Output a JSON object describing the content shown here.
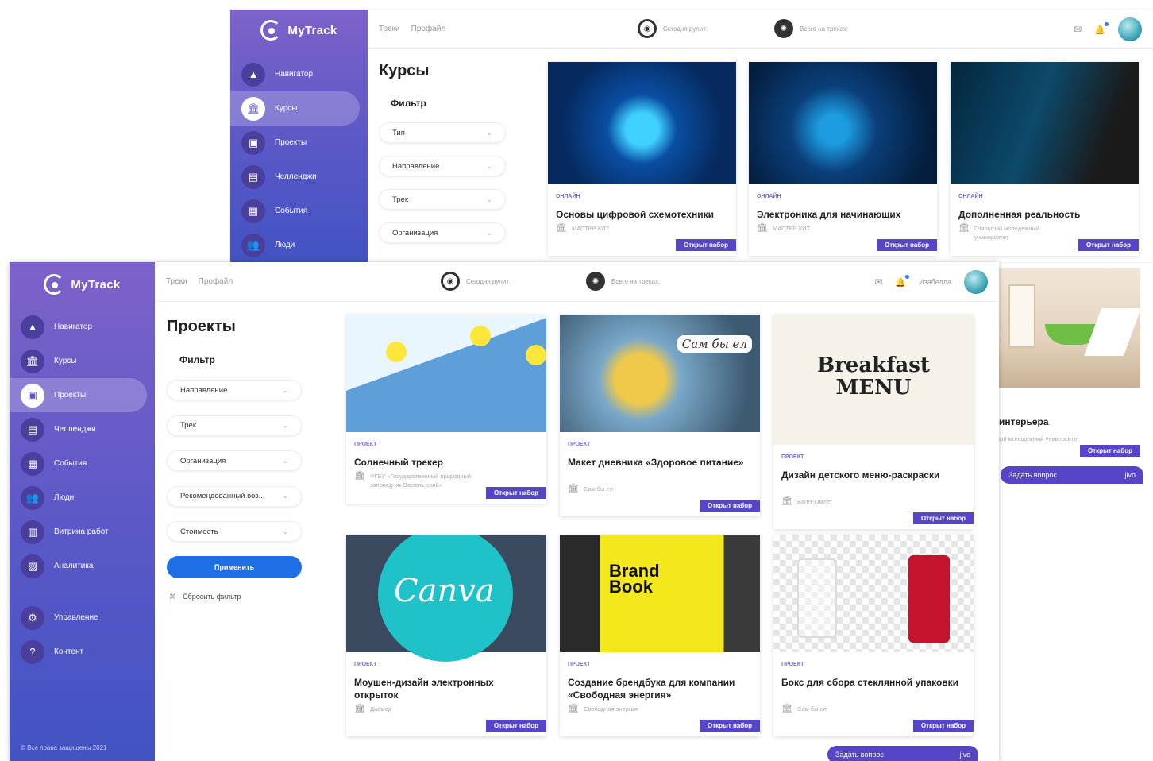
{
  "brand": "MyTrack",
  "back": {
    "topnav": [
      "Треки",
      "Профайл"
    ],
    "stat_today": "Сегодня рулит:",
    "stat_total": "Всего на треках:",
    "sidebar": [
      {
        "label": "Навигатор",
        "icon": "navigator-icon",
        "glyph": "▲"
      },
      {
        "label": "Курсы",
        "icon": "courses-icon",
        "glyph": "🏛",
        "active": true
      },
      {
        "label": "Проекты",
        "icon": "projects-icon",
        "glyph": "▣"
      },
      {
        "label": "Челленджи",
        "icon": "challenges-icon",
        "glyph": "▤"
      },
      {
        "label": "События",
        "icon": "events-icon",
        "glyph": "▦"
      },
      {
        "label": "Люди",
        "icon": "people-icon",
        "glyph": "👥"
      }
    ],
    "page_title": "Курсы",
    "filter_title": "Фильтр",
    "filters": [
      "Тип",
      "Направление",
      "Трек",
      "Организация"
    ],
    "cards": [
      {
        "tag": "онлайн",
        "title": "Основы цифровой схемотехники",
        "org": "МАСТЕР КИТ",
        "button": "Открыт набор"
      },
      {
        "tag": "онлайн",
        "title": "Электроника для начинающих",
        "org": "МАСТЕР КИТ",
        "button": "Открыт набор"
      },
      {
        "tag": "онлайн",
        "title": "Дополненная реальность",
        "org": "Открытый молодежный университет",
        "button": "Открыт набор"
      }
    ]
  },
  "front": {
    "topnav": [
      "Треки",
      "Профайл"
    ],
    "stat_today": "Сегодня рулит:",
    "stat_total": "Всего на треках:",
    "user_name": "Изабелла",
    "sidebar": [
      {
        "label": "Навигатор",
        "icon": "navigator-icon",
        "glyph": "▲"
      },
      {
        "label": "Курсы",
        "icon": "courses-icon",
        "glyph": "🏛"
      },
      {
        "label": "Проекты",
        "icon": "projects-icon",
        "glyph": "▣",
        "active": true
      },
      {
        "label": "Челленджи",
        "icon": "challenges-icon",
        "glyph": "▤"
      },
      {
        "label": "События",
        "icon": "events-icon",
        "glyph": "▦"
      },
      {
        "label": "Люди",
        "icon": "people-icon",
        "glyph": "👥"
      },
      {
        "label": "Витрина работ",
        "icon": "showcase-icon",
        "glyph": "▥"
      },
      {
        "label": "Аналитика",
        "icon": "analytics-icon",
        "glyph": "▨"
      }
    ],
    "sidebar_bottom": [
      {
        "label": "Управление",
        "icon": "settings-icon",
        "glyph": "⚙"
      },
      {
        "label": "Контент",
        "icon": "help-icon",
        "glyph": "?"
      }
    ],
    "copyright": "© Все права защищены 2021",
    "page_title": "Проекты",
    "filter_title": "Фильтр",
    "filters": [
      "Направление",
      "Трек",
      "Организация",
      "Рекомендованный воз...",
      "Стоимость"
    ],
    "apply": "Применить",
    "reset": "Сбросить фильтр",
    "cards": [
      {
        "tag": "проект",
        "title": "Солнечный трекер",
        "org": "ФГБУ «Государственный природный заповедник Васюганский»",
        "button": "Открыт набор"
      },
      {
        "tag": "проект",
        "title": "Макет дневника «Здоровое питание»",
        "org": "Сам бы ел",
        "button": "Открыт набор"
      },
      {
        "tag": "проект",
        "title": "Дизайн детского меню-раскраски",
        "org": "Багет-Омлет",
        "button": "Открыт набор"
      },
      {
        "tag": "проект",
        "title": "Моушен-дизайн электронных открыток",
        "org": "Диамед",
        "button": "Открыт набор"
      },
      {
        "tag": "проект",
        "title": "Создание брендбука для компании «Свободная энергия»",
        "org": "Свободная энергия",
        "button": "Открыт набор"
      },
      {
        "tag": "проект",
        "title": "Бокс для сбора стеклянной упаковки",
        "org": "Сам бы ел",
        "button": "Открыт набор"
      }
    ],
    "ask_chip": "Задать вопрос",
    "ask_brand": "jivo"
  },
  "tail": {
    "title": "интерьера",
    "org": "ый молодежный университет",
    "button": "Открыт набор",
    "ask_chip": "Задать вопрос",
    "ask_brand": "jivo"
  },
  "images": {
    "canva": "Canva",
    "brand_book": "Brand Book",
    "breakfast": "Breakfast MENU",
    "sam_by_el": "Сам бы ел"
  }
}
